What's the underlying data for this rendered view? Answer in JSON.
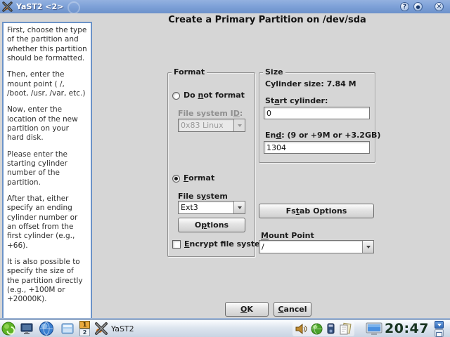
{
  "window": {
    "title": "YaST2 <2>",
    "controls": {
      "help": "?",
      "maximize": "●",
      "close": "✕"
    }
  },
  "help": {
    "paragraphs": [
      "First, choose the type of the partition and whether this partition should be formatted.",
      "Then, enter the mount point ( /, /boot, /usr, /var, etc.)",
      "Now, enter the location of the new partition on your hard disk.",
      "Please enter the starting cylinder number of the partition.",
      "After that, either specify an ending cylinder number or an offset from the first cylinder (e.g., +66).",
      "It is also possible to specify the size of the partition directly (e.g., +100M or +20000K)."
    ]
  },
  "dialog": {
    "title": "Create a Primary Partition on /dev/sda",
    "format_group": {
      "legend": "Format",
      "do_not_format": {
        "pre": "Do ",
        "key": "n",
        "post": "ot format"
      },
      "fs_id_label": {
        "pre": "File system I",
        "key": "D",
        "post": ":"
      },
      "fs_id_value": "0x83 Linux",
      "format_radio": {
        "pre": "",
        "key": "F",
        "post": "ormat"
      },
      "fs_label": {
        "pre": "File s",
        "key": "y",
        "post": "stem"
      },
      "fs_value": "Ext3",
      "options_button": {
        "pre": "O",
        "key": "p",
        "post": "tions"
      },
      "encrypt_checkbox": {
        "pre": "",
        "key": "E",
        "post": "ncrypt file system"
      }
    },
    "size_group": {
      "legend": "Size",
      "cylinder_size": "Cylinder size: 7.84 M",
      "start_label": {
        "pre": "St",
        "key": "a",
        "post": "rt cylinder:"
      },
      "start_value": "0",
      "end_label": {
        "pre": "En",
        "key": "d",
        "post": ":  (9 or +9M or +3.2GB)"
      },
      "end_value": "1304"
    },
    "fstab_button": {
      "pre": "Fs",
      "key": "t",
      "post": "ab Options"
    },
    "mount_label": {
      "pre": "",
      "key": "M",
      "post": "ount Point"
    },
    "mount_value": "/",
    "ok_button": {
      "pre": "",
      "key": "O",
      "post": "K"
    },
    "cancel_button": {
      "pre": "",
      "key": "C",
      "post": "ancel"
    }
  },
  "taskbar": {
    "pager": {
      "desktop1": "1",
      "desktop2": "2"
    },
    "task_label": "YaST2",
    "clock": "20:47"
  },
  "colors": {
    "titlebar": "#7b9fd6",
    "dialog_bg": "#d6d6d6",
    "help_border": "#6b93c8",
    "pager_active": "#e9a93c",
    "clock_text": "#17331f"
  }
}
